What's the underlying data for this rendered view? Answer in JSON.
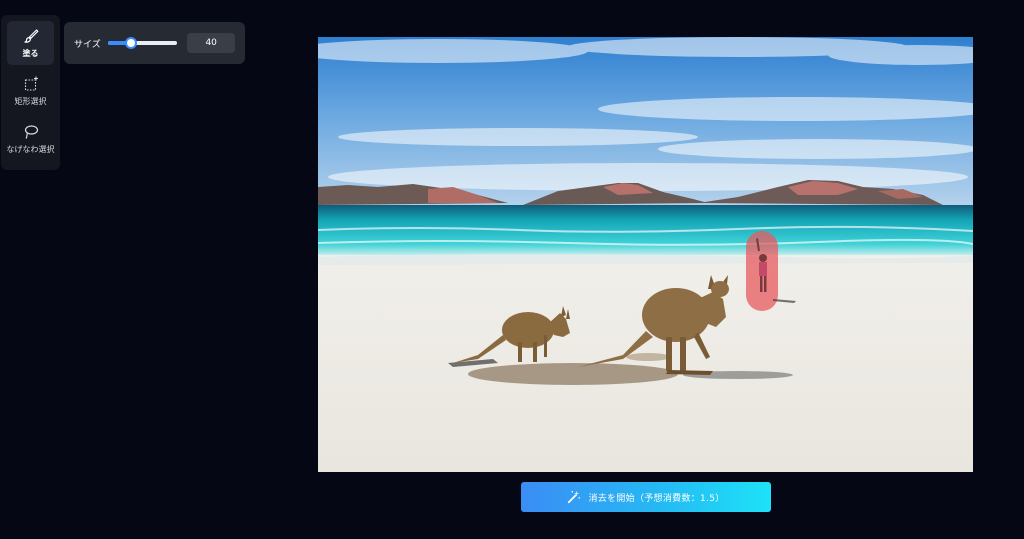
{
  "toolbar": {
    "tools": [
      {
        "label": "塗る",
        "icon": "brush-icon",
        "active": true
      },
      {
        "label": "矩形選択",
        "icon": "rect-select-icon",
        "active": false
      },
      {
        "label": "なげなわ選択",
        "icon": "lasso-icon",
        "active": false
      }
    ]
  },
  "size_panel": {
    "label": "サイズ",
    "value": "40",
    "slider_fraction": 0.33
  },
  "canvas": {
    "mask_color": "#e85a5f"
  },
  "start_button": {
    "label": "消去を開始（予想消費数：1.5）",
    "icon": "magic-wand-icon"
  },
  "colors": {
    "background": "#050814",
    "accent": "#3a8dff"
  }
}
